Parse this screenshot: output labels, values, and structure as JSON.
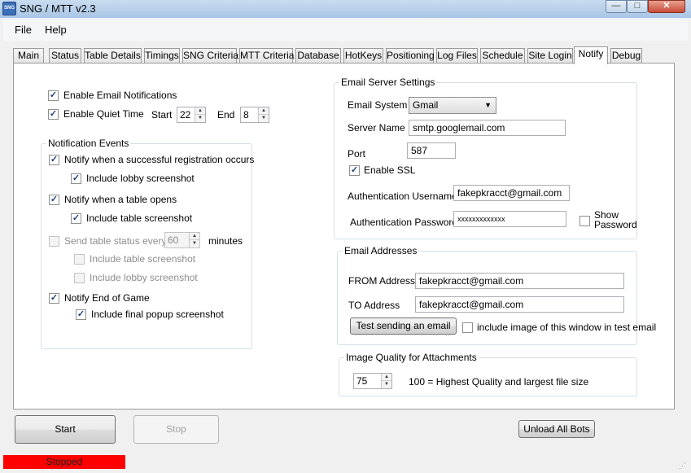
{
  "window": {
    "title": "SNG / MTT  v2.3",
    "icon_text": "SNG",
    "minimize": "—",
    "maximize": "□",
    "close": "✕"
  },
  "menu": [
    {
      "label": "File"
    },
    {
      "label": "Help"
    }
  ],
  "tabs": [
    {
      "label": "Main"
    },
    {
      "label": "Status"
    },
    {
      "label": "Table Details"
    },
    {
      "label": "Timings"
    },
    {
      "label": "SNG Criteria"
    },
    {
      "label": "MTT Criteria"
    },
    {
      "label": "Database"
    },
    {
      "label": "HotKeys"
    },
    {
      "label": "Positioning"
    },
    {
      "label": "Log Files"
    },
    {
      "label": "Schedule"
    },
    {
      "label": "Site Login"
    },
    {
      "label": "Notify"
    },
    {
      "label": "Debug"
    }
  ],
  "active_tab": "Notify",
  "notify": {
    "enable_email": {
      "label": "Enable Email Notifications",
      "checked": true
    },
    "quiet_time": {
      "label": "Enable Quiet Time",
      "checked": true,
      "start_label": "Start",
      "start_value": "22",
      "end_label": "End",
      "end_value": "8"
    },
    "events": {
      "title": "Notification Events",
      "registration": {
        "label": "Notify when a successful registration occurs",
        "checked": true
      },
      "registration_lobby": {
        "label": "Include lobby screenshot",
        "checked": true
      },
      "table_opens": {
        "label": "Notify when a table opens",
        "checked": true
      },
      "table_opens_screenshot": {
        "label": "Include table screenshot",
        "checked": true
      },
      "table_status": {
        "label": "Send table status every",
        "checked": false,
        "value": "60",
        "unit": "minutes"
      },
      "table_status_table": {
        "label": "Include table screenshot",
        "checked": false
      },
      "table_status_lobby": {
        "label": "Include lobby screenshot",
        "checked": false
      },
      "end_game": {
        "label": "Notify End of Game",
        "checked": true
      },
      "end_game_popup": {
        "label": "Include final popup screenshot",
        "checked": true
      }
    },
    "server": {
      "title": "Email Server Settings",
      "system_label": "Email System",
      "system_value": "Gmail",
      "server_label": "Server Name",
      "server_value": "smtp.googlemail.com",
      "port_label": "Port",
      "port_value": "587",
      "ssl": {
        "label": "Enable SSL",
        "checked": true
      },
      "username_label": "Authentication Username",
      "username_value": "fakepkracct@gmail.com",
      "password_label": "Authentication Password",
      "password_value": "xxxxxxxxxxxxx",
      "show_password": {
        "label_line1": "Show",
        "label_line2": "Password",
        "checked": false
      }
    },
    "addresses": {
      "title": "Email Addresses",
      "from_label": "FROM Address",
      "from_value": "fakepkracct@gmail.com",
      "to_label": "TO Address",
      "to_value": "fakepkracct@gmail.com",
      "test_button": "Test sending an email",
      "include_image": {
        "label": "include image of this window in test email",
        "checked": false
      }
    },
    "quality": {
      "title": "Image Quality for Attachments",
      "value": "75",
      "note": "100 = Highest Quality and largest file size"
    }
  },
  "buttons": {
    "start": "Start",
    "stop": "Stop",
    "unload": "Unload All Bots"
  },
  "status": {
    "text": "Stopped",
    "color": "#ff0000"
  },
  "colors": {
    "checkmark": "#1e3f7a",
    "titlebar": "#a9c6e6"
  }
}
